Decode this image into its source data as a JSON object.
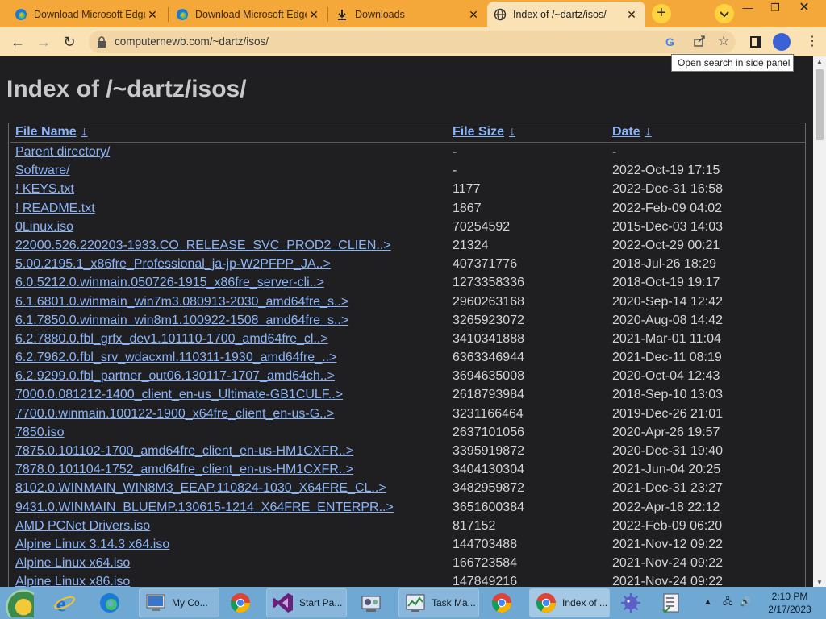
{
  "browser": {
    "tabs": [
      {
        "title": "Download Microsoft Edge",
        "favicon": "edge-icon",
        "active": false
      },
      {
        "title": "Download Microsoft Edge",
        "favicon": "edge-icon",
        "active": false
      },
      {
        "title": "Downloads",
        "favicon": "download-icon",
        "active": false
      },
      {
        "title": "Index of /~dartz/isos/",
        "favicon": "globe-icon",
        "active": true
      }
    ],
    "url": "computernewb.com/~dartz/isos/",
    "tooltip": "Open search in side panel",
    "colors": {
      "tab_strip": "#f4a83a",
      "toolbar": "#fbe2b5",
      "link": "#8ab4f8",
      "page_bg": "#1f1f21"
    }
  },
  "page": {
    "title": "Index of /~dartz/isos/",
    "columns": {
      "name": "File Name",
      "size": "File Size",
      "date": "Date",
      "sort_arrow": "↓"
    },
    "rows": [
      {
        "name": "Parent directory/",
        "size": "-",
        "date": "-"
      },
      {
        "name": "Software/",
        "size": "-",
        "date": "2022-Oct-19 17:15"
      },
      {
        "name": "! KEYS.txt",
        "size": "1177",
        "date": "2022-Dec-31 16:58"
      },
      {
        "name": "! README.txt",
        "size": "1867",
        "date": "2022-Feb-09 04:02"
      },
      {
        "name": "0Linux.iso",
        "size": "70254592",
        "date": "2015-Dec-03 14:03"
      },
      {
        "name": "22000.526.220203-1933.CO_RELEASE_SVC_PROD2_CLIEN..>",
        "size": "21324",
        "date": "2022-Oct-29 00:21"
      },
      {
        "name": "5.00.2195.1_x86fre_Professional_ja-jp-W2PFPP_JA..>",
        "size": "407371776",
        "date": "2018-Jul-26 18:29"
      },
      {
        "name": "6.0.5212.0.winmain.050726-1915_x86fre_server-cli..>",
        "size": "1273358336",
        "date": "2018-Oct-19 19:17"
      },
      {
        "name": "6.1.6801.0.winmain_win7m3.080913-2030_amd64fre_s..>",
        "size": "2960263168",
        "date": "2020-Sep-14 12:42"
      },
      {
        "name": "6.1.7850.0.winmain_win8m1.100922-1508_amd64fre_s..>",
        "size": "3265923072",
        "date": "2020-Aug-08 14:42"
      },
      {
        "name": "6.2.7880.0.fbl_grfx_dev1.101110-1700_amd64fre_cl..>",
        "size": "3410341888",
        "date": "2021-Mar-01 11:04"
      },
      {
        "name": "6.2.7962.0.fbl_srv_wdacxml.110311-1930_amd64fre_..>",
        "size": "6363346944",
        "date": "2021-Dec-11 08:19"
      },
      {
        "name": "6.2.9299.0.fbl_partner_out06.130117-1707_amd64ch..>",
        "size": "3694635008",
        "date": "2020-Oct-04 12:43"
      },
      {
        "name": "7000.0.081212-1400_client_en-us_Ultimate-GB1CULF..>",
        "size": "2618793984",
        "date": "2018-Sep-10 13:03"
      },
      {
        "name": "7700.0.winmain.100122-1900_x64fre_client_en-us-G..>",
        "size": "3231166464",
        "date": "2019-Dec-26 21:01"
      },
      {
        "name": "7850.iso",
        "size": "2637101056",
        "date": "2020-Apr-26 19:57"
      },
      {
        "name": "7875.0.101102-1700_amd64fre_client_en-us-HM1CXFR..>",
        "size": "3395919872",
        "date": "2020-Dec-31 19:40"
      },
      {
        "name": "7878.0.101104-1752_amd64fre_client_en-us-HM1CXFR..>",
        "size": "3404130304",
        "date": "2021-Jun-04 20:25"
      },
      {
        "name": "8102.0.WINMAIN_WIN8M3_EEAP.110824-1030_X64FRE_CL..>",
        "size": "3482959872",
        "date": "2021-Dec-31 23:27"
      },
      {
        "name": "9431.0.WINMAIN_BLUEMP.130615-1214_X64FRE_ENTERPR..>",
        "size": "3651600384",
        "date": "2022-Apr-18 22:12"
      },
      {
        "name": "AMD PCNet Drivers.iso",
        "size": "817152",
        "date": "2022-Feb-09 06:20"
      },
      {
        "name": "Alpine Linux 3.14.3 x64.iso",
        "size": "144703488",
        "date": "2021-Nov-12 09:22"
      },
      {
        "name": "Alpine Linux x64.iso",
        "size": "166723584",
        "date": "2021-Nov-24 09:22"
      },
      {
        "name": "Alpine Linux x86.iso",
        "size": "147849216",
        "date": "2021-Nov-24 09:22"
      }
    ]
  },
  "taskbar": {
    "items": [
      {
        "label": "",
        "icon": "start-orb-icon"
      },
      {
        "label": "",
        "icon": "internet-explorer-icon"
      },
      {
        "label": "",
        "icon": "edge-icon"
      },
      {
        "label": "My Co...",
        "icon": "my-computer-icon"
      },
      {
        "label": "",
        "icon": "chrome-icon"
      },
      {
        "label": "Start Pa...",
        "icon": "visual-studio-icon"
      },
      {
        "label": "",
        "icon": "control-panel-icon"
      },
      {
        "label": "Task Ma...",
        "icon": "task-manager-icon"
      },
      {
        "label": "",
        "icon": "chrome-icon"
      },
      {
        "label": "Index of ...",
        "icon": "chrome-icon"
      },
      {
        "label": "",
        "icon": "virus-icon"
      },
      {
        "label": "",
        "icon": "checklist-icon"
      }
    ],
    "clock": {
      "time": "2:10 PM",
      "date": "2/17/2023"
    }
  }
}
